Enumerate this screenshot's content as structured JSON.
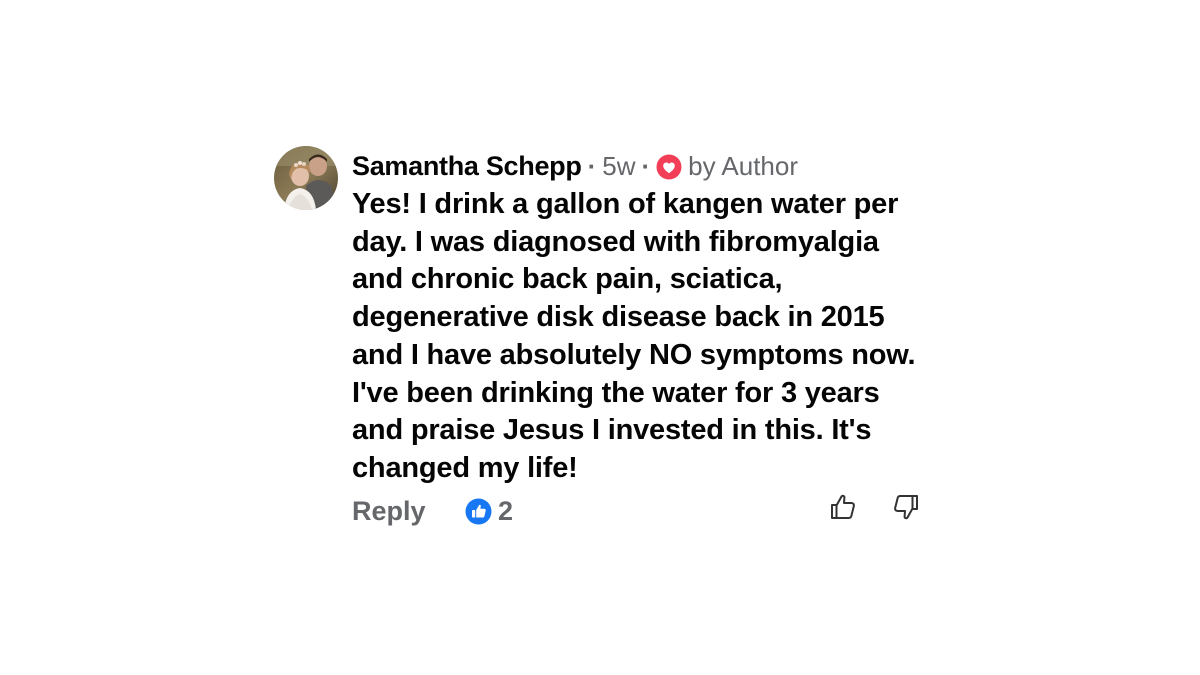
{
  "comment": {
    "author": "Samantha Schepp",
    "separator": "·",
    "time": "5w",
    "loved_by": "by Author",
    "text": "Yes! I drink a gallon of kangen water per day. I was diagnosed with fibromyalgia and chronic back pain, sciatica, degenerative disk disease back in 2015 and I have absolutely NO symptoms now. I've been drinking the water for 3 years and praise Jesus I invested in this. It's changed my life!",
    "reply_label": "Reply",
    "reaction_count": "2"
  },
  "colors": {
    "text_primary": "#050505",
    "text_secondary": "#65676b",
    "like_blue": "#1877f2",
    "love_red": "#f33e58"
  },
  "icons": {
    "avatar": "profile-photo",
    "loved": "heart-icon",
    "reaction": "like-icon",
    "thumb_up": "thumbs-up-icon",
    "thumb_down": "thumbs-down-icon"
  }
}
